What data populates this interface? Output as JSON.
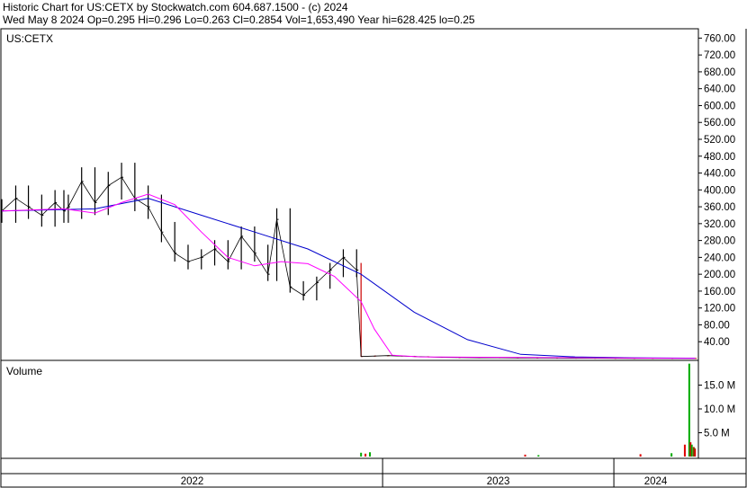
{
  "header": {
    "line1": "Historic Chart for US:CETX by Stockwatch.com 604.687.1500 - (c) 2024",
    "line2": "Wed May  8 2024   Op=0.295   Hi=0.296   Lo=0.263   Cl=0.2854   Vol=1,653,490   Year hi=628.425   lo=0.25"
  },
  "colors": {
    "price_bars": "#000000",
    "ma_short": "#ff00ff",
    "ma_long": "#0000cc",
    "volume_up": "#00aa00",
    "volume_down": "#dd0000",
    "low_price_segment": "#cc0000"
  },
  "chart_data": [
    {
      "type": "line",
      "panel": "price",
      "title": "US:CETX",
      "ylim": [
        0,
        780
      ],
      "y_ticks": [
        "760.00",
        "720.00",
        "680.00",
        "640.00",
        "600.00",
        "560.00",
        "520.00",
        "480.00",
        "440.00",
        "400.00",
        "360.00",
        "320.00",
        "280.00",
        "240.00",
        "200.00",
        "160.00",
        "120.00",
        "80.00",
        "40.00"
      ],
      "x_ticks": [
        "2022",
        "2023",
        "2024"
      ],
      "series": [
        {
          "kind": "price_hl_bars",
          "x": [
            "2021-05-10",
            "2021-06-01",
            "2021-06-21",
            "2021-07-12",
            "2021-08-02",
            "2021-08-16",
            "2021-08-23",
            "2021-09-13",
            "2021-10-04",
            "2021-10-25",
            "2021-11-15",
            "2021-12-06",
            "2021-12-27",
            "2022-01-17",
            "2022-02-07",
            "2022-02-28",
            "2022-03-21",
            "2022-04-11",
            "2022-05-02",
            "2022-05-23",
            "2022-06-13",
            "2022-07-04",
            "2022-07-18",
            "2022-08-08",
            "2022-08-29",
            "2022-09-19",
            "2022-10-10",
            "2022-10-31",
            "2022-11-21",
            "2022-11-28",
            "2022-12-19",
            "2023-01-09",
            "2023-01-30",
            "2023-02-20",
            "2023-03-13",
            "2023-04-03",
            "2023-05-01",
            "2023-06-01",
            "2023-07-03",
            "2023-08-01",
            "2023-09-01",
            "2023-10-02",
            "2023-11-01",
            "2023-12-01",
            "2024-01-02",
            "2024-02-01",
            "2024-03-01",
            "2024-04-01",
            "2024-05-08"
          ],
          "values": [
            350,
            380,
            360,
            340,
            370,
            350,
            360,
            420,
            370,
            410,
            430,
            380,
            360,
            300,
            250,
            230,
            240,
            260,
            230,
            290,
            250,
            200,
            330,
            170,
            150,
            180,
            210,
            240,
            210,
            5,
            6,
            7,
            6,
            5,
            4,
            3,
            2.5,
            2,
            2,
            1.5,
            1.3,
            1,
            0.9,
            0.8,
            0.6,
            0.5,
            0.4,
            0.35,
            0.2854
          ]
        },
        {
          "name": "",
          "kind": "moving_average_short",
          "x": [
            "2021-05-10",
            "2021-08-16",
            "2021-10-04",
            "2021-11-15",
            "2021-12-27",
            "2022-02-07",
            "2022-03-21",
            "2022-05-02",
            "2022-06-13",
            "2022-07-25",
            "2022-09-05",
            "2022-10-17",
            "2022-11-28",
            "2022-12-19",
            "2023-01-16",
            "2023-03-01",
            "2024-05-08"
          ],
          "values": [
            350,
            355,
            345,
            370,
            390,
            365,
            300,
            240,
            220,
            230,
            225,
            195,
            135,
            70,
            8,
            4,
            0.4
          ]
        },
        {
          "name": "",
          "kind": "moving_average_long",
          "x": [
            "2021-05-10",
            "2021-10-04",
            "2021-12-27",
            "2022-03-21",
            "2022-06-13",
            "2022-09-05",
            "2022-11-28",
            "2023-02-20",
            "2023-05-15",
            "2023-08-07",
            "2023-11-01",
            "2024-01-29",
            "2024-05-08"
          ],
          "values": [
            350,
            355,
            380,
            340,
            300,
            260,
            200,
            110,
            45,
            10,
            4,
            2,
            1
          ]
        }
      ]
    },
    {
      "type": "bar",
      "panel": "volume",
      "title": "Volume",
      "ylim": [
        0,
        20000000
      ],
      "y_ticks": [
        "15.0 M",
        "10.0 M",
        "5.0 M"
      ],
      "x": [
        "2022-11-28",
        "2022-12-05",
        "2022-12-12",
        "2023-08-14",
        "2023-09-04",
        "2024-02-12",
        "2024-04-01",
        "2024-04-22",
        "2024-04-29",
        "2024-05-01",
        "2024-05-03",
        "2024-05-06",
        "2024-05-07",
        "2024-05-08"
      ],
      "values": [
        800000,
        600000,
        900000,
        400000,
        300000,
        500000,
        700000,
        2500000,
        19500000,
        3000000,
        2500000,
        2000000,
        1800000,
        1653490
      ]
    }
  ]
}
